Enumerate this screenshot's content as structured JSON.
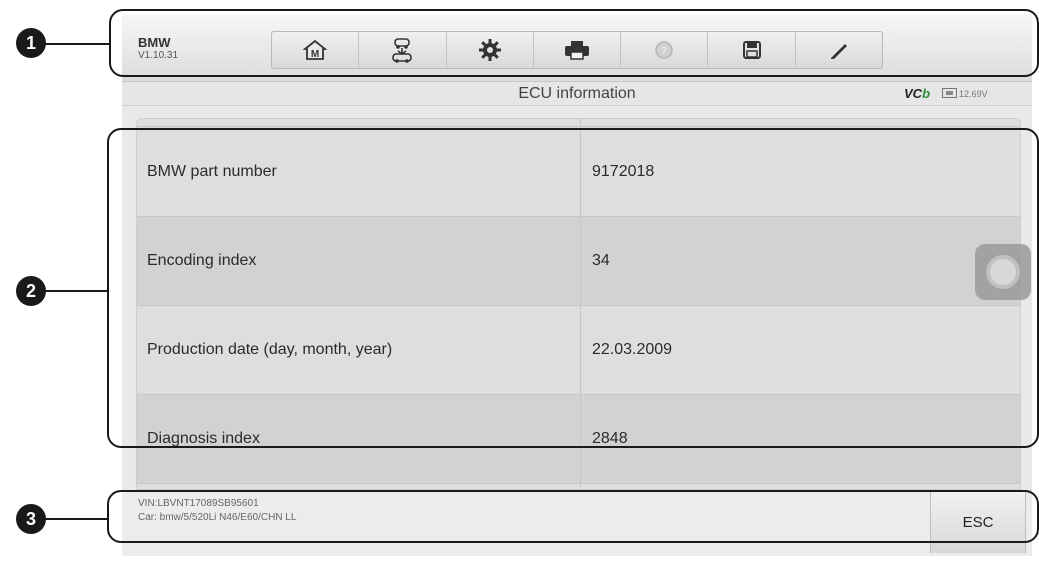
{
  "toolbar": {
    "brand": "BMW",
    "version": "V1.10.31",
    "buttons": [
      {
        "name": "home",
        "icon": "home-icon"
      },
      {
        "name": "vehicle-swap",
        "icon": "vehicle-swap-icon"
      },
      {
        "name": "settings",
        "icon": "gear-icon"
      },
      {
        "name": "print",
        "icon": "printer-icon"
      },
      {
        "name": "help",
        "icon": "help-icon"
      },
      {
        "name": "save",
        "icon": "save-icon"
      },
      {
        "name": "data-logging",
        "icon": "pen-icon"
      }
    ]
  },
  "header": {
    "title": "ECU information",
    "vci_label_prefix": "VC",
    "vci_label_suffix": "b",
    "battery_voltage": "12.69V"
  },
  "table": {
    "rows": [
      {
        "label": "BMW part number",
        "value": "9172018"
      },
      {
        "label": "Encoding index",
        "value": "34"
      },
      {
        "label": "Production date (day, month, year)",
        "value": "22.03.2009"
      },
      {
        "label": "Diagnosis index",
        "value": "2848"
      }
    ]
  },
  "footer": {
    "vin": "VIN:LBVNT17089SB95601",
    "car": "Car: bmw/5/520Li N46/E60/CHN LL",
    "esc_label": "ESC"
  },
  "callouts": [
    "1",
    "2",
    "3"
  ],
  "colors": {
    "vci_accent": "#2f8f3a",
    "callout": "#1a1a1a"
  }
}
